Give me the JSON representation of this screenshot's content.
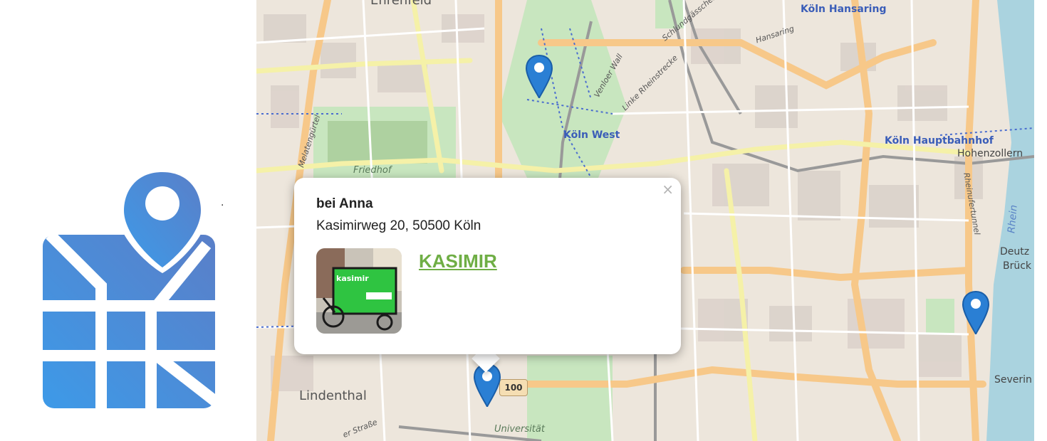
{
  "app": {
    "logo_icon": "map-with-pin-icon",
    "dot": ".",
    "colors": {
      "logo_gradient_start": "#3d9ae8",
      "logo_gradient_end": "#5a7fc8",
      "link": "#6fae45",
      "marker": "#2a7fd4"
    }
  },
  "map": {
    "labels": {
      "ehrenfeld": "Ehrenfeld",
      "koeln_hansaring": "Köln Hansaring",
      "hansaring": "Hansaring",
      "schlundgasse": "Schlundgässchen",
      "venloer_wall": "Venloer Wall",
      "linke_rheinstrecke": "Linke Rheinstrecke",
      "koeln_west": "Köln West",
      "koeln_hbf": "Köln Hauptbahnhof",
      "hohenzollern": "Hohenzollern",
      "rheinufertunnel": "Rheinufertunnel",
      "rhein": "Rhein",
      "deutz": "Deutz",
      "bruck": "Brück",
      "severin": "Severin",
      "melatenguertel": "Melatengürtel",
      "friedhof": "Friedhof",
      "lindenthal": "Lindenthal",
      "strasse": "er Straße",
      "universitaet": "Universität",
      "road_shield": "100"
    },
    "markers": [
      {
        "name": "marker-north",
        "icon": "map-pin-icon"
      },
      {
        "name": "marker-selected",
        "icon": "map-pin-icon"
      },
      {
        "name": "marker-east",
        "icon": "map-pin-icon"
      }
    ]
  },
  "popup": {
    "close_label": "×",
    "title": "bei Anna",
    "address": "Kasimirweg 20, 50500 Köln",
    "photo_icon": "cargo-bike-photo",
    "photo_sign": "kasimir",
    "link_label": "KASIMIR"
  }
}
